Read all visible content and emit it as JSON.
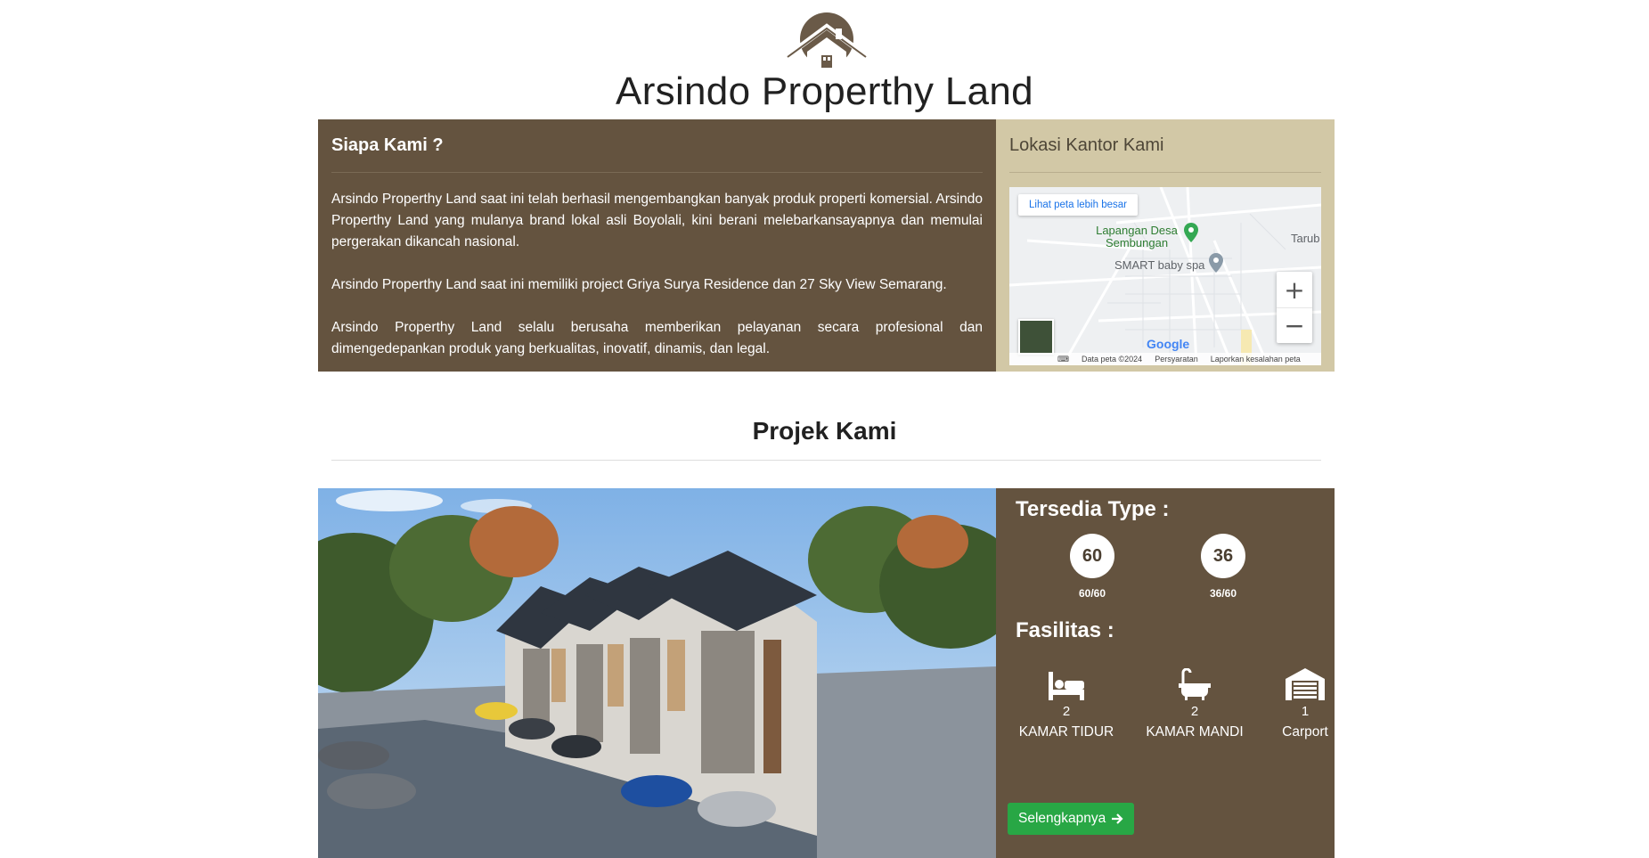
{
  "header": {
    "title": "Arsindo Properthy Land"
  },
  "about": {
    "heading": "Siapa Kami ?",
    "paragraphs": [
      "Arsindo Properthy Land saat ini telah berhasil mengembangkan banyak produk properti komersial. Arsindo Properthy Land yang mulanya brand lokal asli Boyolali, kini berani melebarkansayapnya dan memulai pergerakan dikancah nasional.",
      "Arsindo Properthy Land saat ini memiliki project Griya Surya Residence dan 27 Sky View Semarang.",
      "Arsindo Properthy Land selalu berusaha memberikan pelayanan secara profesional dan dimengedepankan produk yang berkualitas, inovatif, dinamis, dan legal."
    ]
  },
  "location": {
    "heading": "Lokasi Kantor Kami",
    "map": {
      "larger_map_link": "Lihat peta lebih besar",
      "poi_1": "Lapangan Desa Sembungan",
      "poi_2": "SMART baby spa",
      "edge_label": "Tarub",
      "zoom_in": "+",
      "zoom_out": "−",
      "google": "Google",
      "footer_data": "Data peta ©2024",
      "footer_terms": "Persyaratan",
      "footer_report": "Laporkan kesalahan peta"
    }
  },
  "projects": {
    "title": "Projek Kami",
    "card": {
      "types_heading": "Tersedia Type :",
      "types": [
        {
          "value": "60",
          "label": "60/60"
        },
        {
          "value": "36",
          "label": "36/60"
        }
      ],
      "facilities_heading": "Fasilitas :",
      "facilities": [
        {
          "icon": "bed-icon",
          "count": "2",
          "label": "KAMAR TIDUR"
        },
        {
          "icon": "bathtub-icon",
          "count": "2",
          "label": "KAMAR MANDI"
        },
        {
          "icon": "garage-icon",
          "count": "1",
          "label": "Carport"
        }
      ],
      "button_label": "Selengkapnya",
      "button_icon": "arrow-right-icon"
    }
  },
  "colors": {
    "brown": "#64533f",
    "beige": "#d2c8a6",
    "green_button": "#28a745"
  }
}
